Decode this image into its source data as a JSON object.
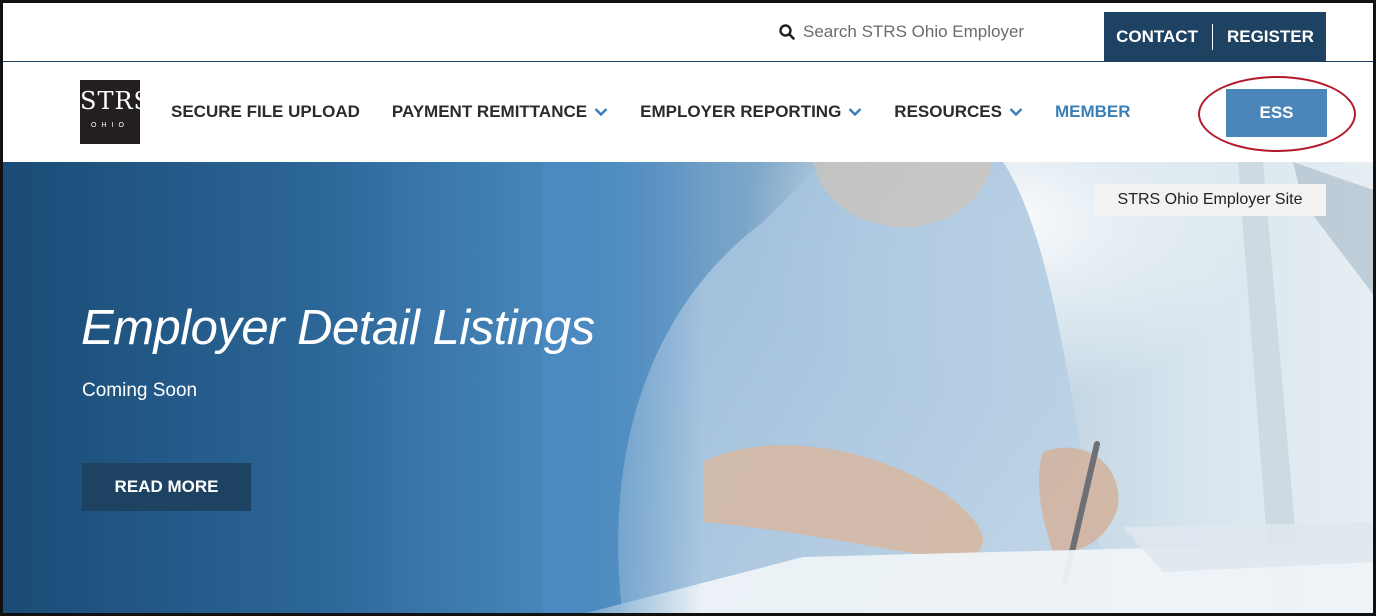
{
  "header": {
    "search_placeholder": "Search STRS Ohio Employer",
    "contact_label": "CONTACT",
    "register_label": "REGISTER"
  },
  "logo": {
    "mark": "STRS",
    "subtext": "OHIO"
  },
  "nav": {
    "items": [
      {
        "label": "SECURE FILE UPLOAD"
      },
      {
        "label": "PAYMENT REMITTANCE"
      },
      {
        "label": "EMPLOYER REPORTING"
      },
      {
        "label": "RESOURCES"
      },
      {
        "label": "MEMBER"
      }
    ],
    "ess_label": "ESS"
  },
  "hero": {
    "site_tag": "STRS Ohio Employer Site",
    "title": "Employer Detail Listings",
    "subtitle": "Coming Soon",
    "button_label": "READ MORE"
  },
  "colors": {
    "navy": "#1d4262",
    "accent_blue": "#4a86b8",
    "member_link": "#3a7fb8",
    "highlight_ring": "#b3192c"
  }
}
